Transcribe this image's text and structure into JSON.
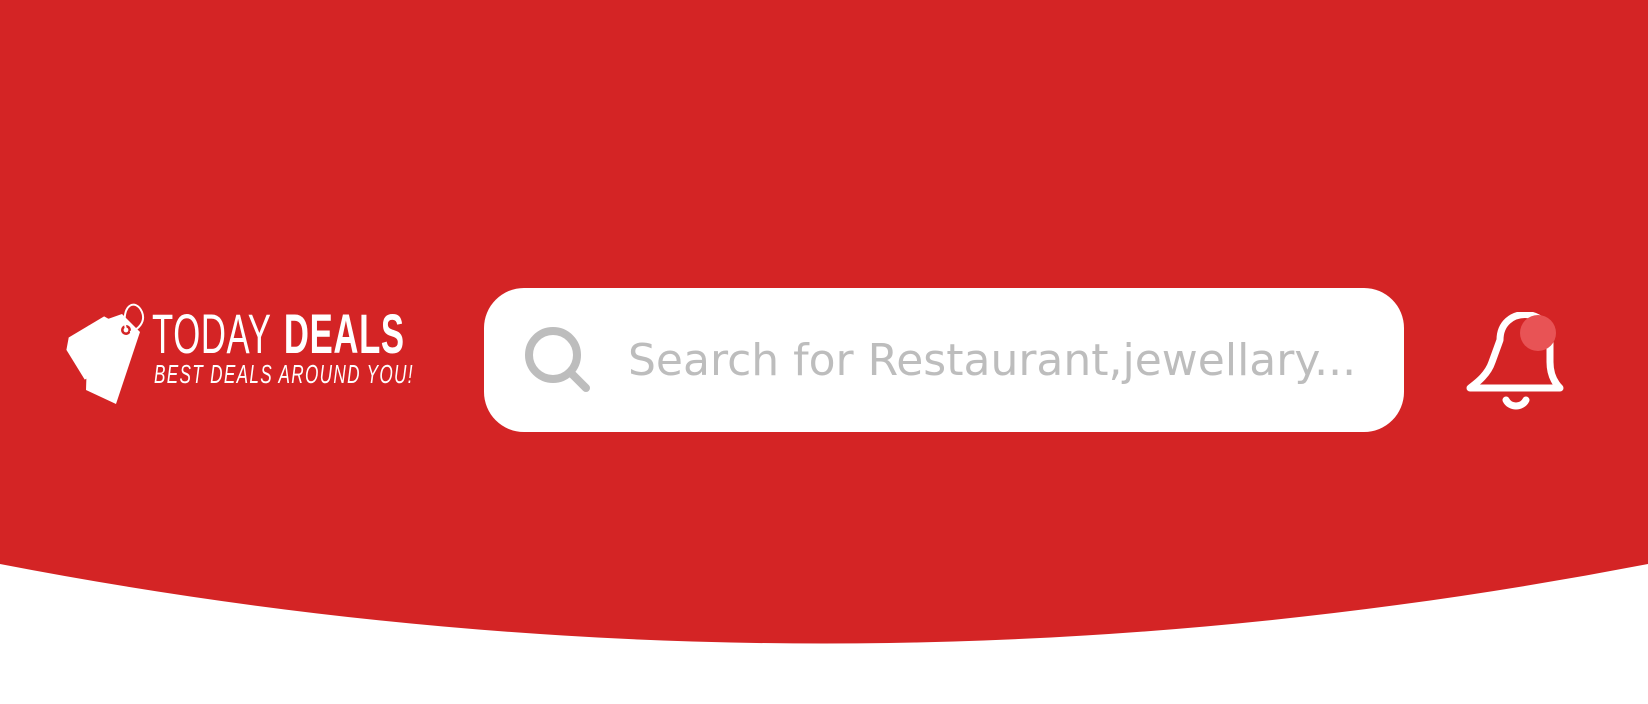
{
  "colors": {
    "header_red": "#d42425",
    "search_bg": "#ffffff",
    "placeholder_gray": "#bdbdbd",
    "icon_gray": "#bdbdbd",
    "notification_dot": "#e85355"
  },
  "logo": {
    "title_thin": "TODAY",
    "title_bold": "DEALS",
    "tagline": "BEST DEALS AROUND YOU!",
    "icon": "price-tag-icon"
  },
  "search": {
    "placeholder": "Search for Restaurant,jewellary...",
    "value": "",
    "icon": "search-icon"
  },
  "notifications": {
    "icon": "bell-icon",
    "has_unread": true
  }
}
